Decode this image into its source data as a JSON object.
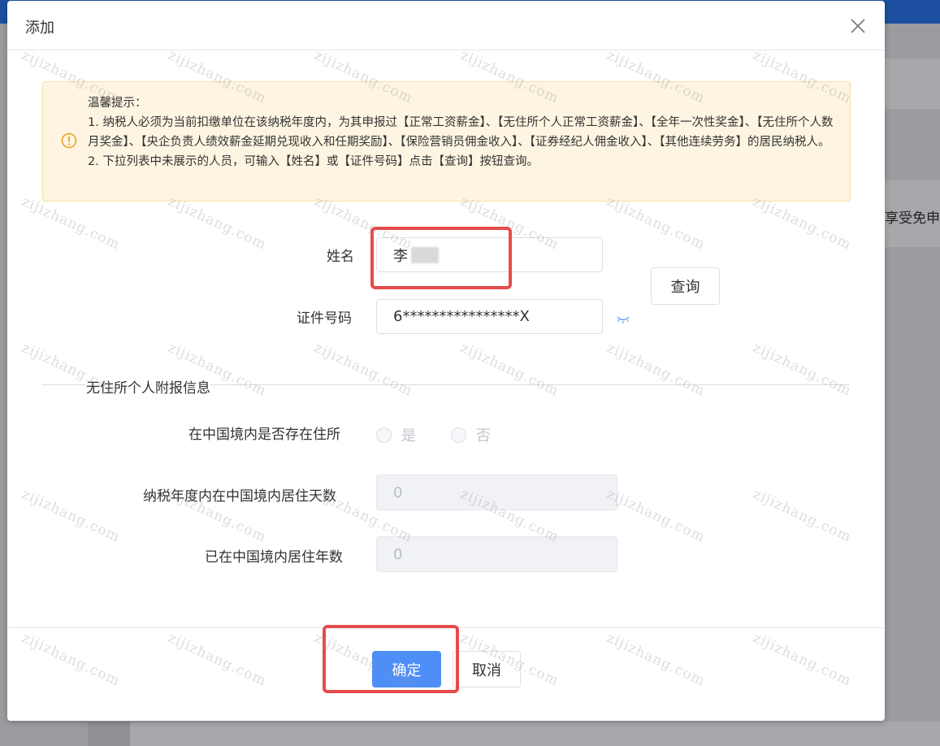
{
  "background": {
    "cut_text": "享受免申报",
    "topbar_color": "#1d4fa1"
  },
  "dialog": {
    "title": "添加",
    "close_icon": "close-icon"
  },
  "tip": {
    "icon": "warning-circle-icon",
    "lines": [
      "温馨提示：",
      "1. 纳税人必须为当前扣缴单位在该纳税年度内，为其申报过【正常工资薪金】、【无住所个人正常工资薪金】、【全年一次性奖金】、【无住所个人数月奖金】、【央企负责人绩效薪金延期兑现收入和任期奖励】、【保险营销员佣金收入】、【证券经纪人佣金收入】、【其他连续劳务】的居民纳税人。",
      "2. 下拉列表中未展示的人员，可输入【姓名】或【证件号码】点击【查询】按钮查询。"
    ]
  },
  "form": {
    "name_label": "姓名",
    "name_value": "李",
    "id_label": "证件号码",
    "id_value": "6****************X",
    "query_button": "查询",
    "eye_icon": "eye-closed-icon"
  },
  "section": {
    "title": "无住所个人附报信息"
  },
  "residence": {
    "label": "在中国境内是否存在住所",
    "options": [
      "是",
      "否"
    ]
  },
  "days": {
    "label": "纳税年度内在中国境内居住天数",
    "value": "0"
  },
  "years": {
    "label": "已在中国境内居住年数",
    "value": "0"
  },
  "footer": {
    "confirm": "确定",
    "cancel": "取消"
  },
  "watermark": "zijizhang.com",
  "colors": {
    "primary": "#4e8ef7",
    "highlight": "#e64b4b",
    "tip_bg": "#fdf5e1",
    "tip_icon": "#f0a020"
  }
}
